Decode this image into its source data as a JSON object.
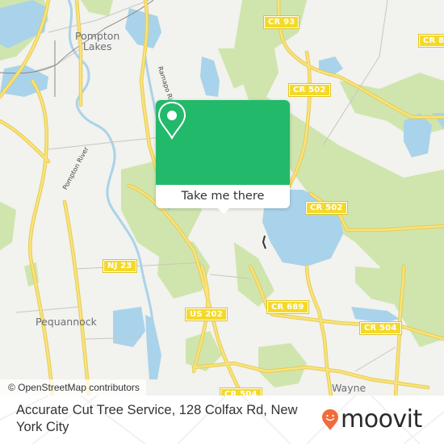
{
  "map": {
    "attribution": "© OpenStreetMap contributors",
    "places": [
      {
        "name": "Pompton\nLakes",
        "key": "pompton_lakes"
      },
      {
        "name": "Pequannock",
        "key": "pequannock"
      },
      {
        "name": "Wayne",
        "key": "wayne"
      }
    ],
    "rivers": {
      "ramapo": "Ramapo River",
      "pompton": "Pompton River"
    },
    "road_shields": {
      "cr93": "CR 93",
      "cr502_top": "CR 502",
      "cr502_lake": "CR 502",
      "nj23": "NJ 23",
      "us202": "US 202",
      "cr689": "CR 689",
      "cr504_east": "CR 504",
      "cr504_south": "CR 504",
      "cr8x": "CR 8"
    },
    "colors": {
      "land": "#f2f2ee",
      "park": "#cfe5ad",
      "water": "#a9d3ea",
      "road": "#f6dc6a",
      "shield": "#f4d92a",
      "accent": "#22b96a"
    }
  },
  "popup": {
    "icon": "map-pin-icon",
    "button_label": "Take me there"
  },
  "footer": {
    "address": "Accurate Cut Tree Service, 128 Colfax Rd, New York City",
    "brand": "moovit",
    "brand_color": "#f26b3a"
  }
}
